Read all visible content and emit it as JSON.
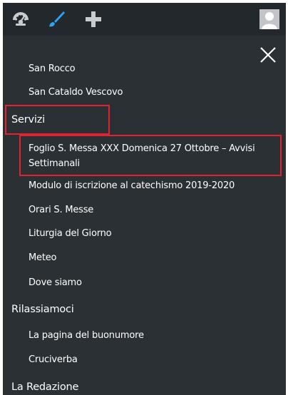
{
  "adminbar": {
    "icons": [
      "dashboard-icon",
      "customize-brush-icon",
      "plus-icon",
      "user-avatar-icon"
    ]
  },
  "menu": {
    "partial_item": "San Rocco",
    "items": [
      {
        "label": "San Cataldo Vescovo",
        "level": "sub"
      },
      {
        "label": "Servizi",
        "level": "top"
      },
      {
        "label": "Foglio S. Messa XXX Domenica 27 Ottobre – Avvisi Settimanali",
        "level": "sub"
      },
      {
        "label": "Modulo di iscrizione al catechismo 2019-2020",
        "level": "sub"
      },
      {
        "label": "Orari S. Messe",
        "level": "sub"
      },
      {
        "label": "Liturgia del Giorno",
        "level": "sub"
      },
      {
        "label": "Meteo",
        "level": "sub"
      },
      {
        "label": "Dove siamo",
        "level": "sub"
      },
      {
        "label": "Rilassiamoci",
        "level": "top"
      },
      {
        "label": "La pagina del buonumore",
        "level": "sub"
      },
      {
        "label": "Cruciverba",
        "level": "sub"
      },
      {
        "label": "La Redazione",
        "level": "top"
      }
    ]
  },
  "colors": {
    "panel_bg": "#2b3034",
    "adminbar_bg": "#23282d",
    "highlight": "#e2232f",
    "brush_blue": "#2ea2f5",
    "text": "#ffffff"
  }
}
